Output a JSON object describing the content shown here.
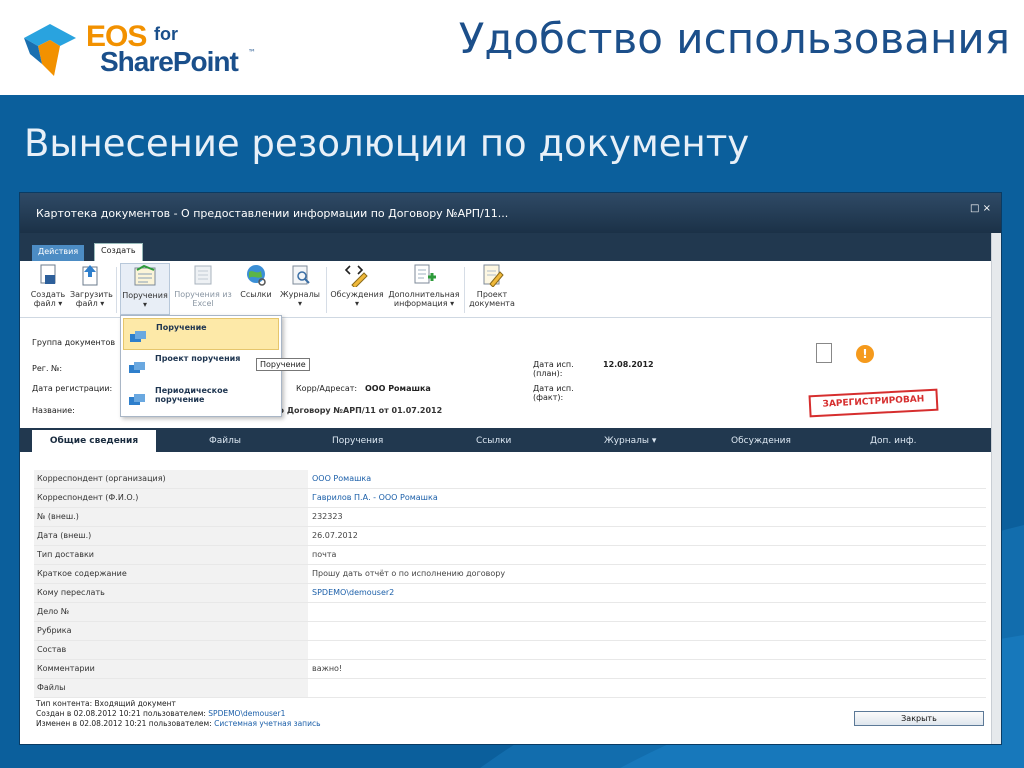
{
  "slide": {
    "title": "Удобство использования",
    "subtitle": "Вынесение резолюции по документу",
    "logo": {
      "eos": "EOS",
      "for": "for",
      "sharepoint": "SharePoint",
      "tm": "™"
    }
  },
  "window": {
    "title": "Картотека документов - О предоставлении информации по Договору №АРП/11...",
    "buttons": "□ ×"
  },
  "ribbon_tabs": {
    "actions": "Действия",
    "create": "Создать"
  },
  "ribbon": {
    "create_file": [
      "Создать",
      "файл ▾"
    ],
    "upload_file": [
      "Загрузить",
      "файл ▾"
    ],
    "tasks": [
      "Поручения",
      "▾"
    ],
    "tasks_excel": [
      "Поручения из",
      "Excel"
    ],
    "links": [
      "Ссылки",
      ""
    ],
    "journals": [
      "Журналы",
      "▾"
    ],
    "discussions": [
      "Обсуждения",
      "▾"
    ],
    "extra_info": [
      "Дополнительная",
      "информация ▾"
    ],
    "draft_doc": [
      "Проект",
      "документа"
    ]
  },
  "dropdown": {
    "items": [
      "Поручение",
      "Проект поручения",
      "Периодическое поручение"
    ],
    "tooltip": "Поручение"
  },
  "form": {
    "group_label": "Группа документов",
    "reg_no_label": "Рег. №:",
    "reg_date_label": "Дата регистрации:",
    "name_label": "Название:",
    "name_value": "О предоставлении информации по Договору №АРП/11 от 01.07.2012",
    "corr_label": "Корр/Адресат:",
    "corr_value": "ООО Ромашка",
    "due_plan_label": "Дата исп. (план):",
    "due_plan_value": "12.08.2012",
    "due_fact_label": "Дата исп. (факт):",
    "status": "ЗАРЕГИСТРИРОВАН",
    "warn": "!"
  },
  "tabs": [
    "Общие сведения",
    "Файлы",
    "Поручения",
    "Ссылки",
    "Журналы ▾",
    "Обсуждения",
    "Доп. инф."
  ],
  "details": [
    {
      "key": "Корреспондент (организация)",
      "value": "ООО Ромашка",
      "link": true
    },
    {
      "key": "Корреспондент (Ф.И.О.)",
      "value": "Гаврилов П.А. - ООО Ромашка",
      "link": true
    },
    {
      "key": "№ (внеш.)",
      "value": "232323",
      "link": false
    },
    {
      "key": "Дата (внеш.)",
      "value": "26.07.2012",
      "link": false
    },
    {
      "key": "Тип доставки",
      "value": "почта",
      "link": false
    },
    {
      "key": "Краткое содержание",
      "value": "Прошу дать отчёт о по исполнению договору",
      "link": false
    },
    {
      "key": "Кому переслать",
      "value": "SPDEMO\\demouser2",
      "link": true
    },
    {
      "key": "Дело №",
      "value": "",
      "link": false
    },
    {
      "key": "Рубрика",
      "value": "",
      "link": false
    },
    {
      "key": "Состав",
      "value": "",
      "link": false
    },
    {
      "key": "Комментарии",
      "value": "важно!",
      "link": false
    },
    {
      "key": "Файлы",
      "value": "",
      "link": false
    }
  ],
  "footer": {
    "content_type": "Тип контента: Входящий документ",
    "created_prefix": "Создан в 02.08.2012 10:21 пользователем:",
    "created_user": "SPDEMO\\demouser1",
    "modified_prefix": "Изменен в 02.08.2012 10:21 пользователем:",
    "modified_user": "Системная учетная запись",
    "close": "Закрыть"
  },
  "colors": {
    "brand_orange": "#f29100",
    "brand_blue": "#1a4f8b",
    "background": "#0b5f9c",
    "status_red": "#d62e2e"
  }
}
